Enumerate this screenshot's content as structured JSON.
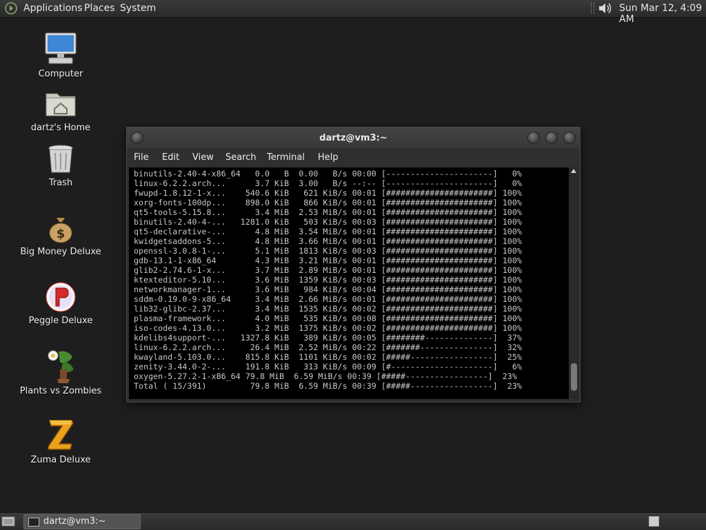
{
  "top_panel": {
    "menus": [
      "Applications",
      "Places",
      "System"
    ],
    "clock": "Sun Mar 12,  4:09 AM",
    "icons": {
      "menu": "gnome-foot-icon",
      "volume": "speaker-icon"
    }
  },
  "desktop": {
    "icons": [
      {
        "label": "Computer",
        "icon": "computer-icon"
      },
      {
        "label": "dartz's Home",
        "icon": "home-folder-icon"
      },
      {
        "label": "Trash",
        "icon": "trash-icon"
      },
      {
        "label": "Big Money Deluxe",
        "icon": "money-bag-icon"
      },
      {
        "label": "Peggle Deluxe",
        "icon": "peggle-icon"
      },
      {
        "label": "Plants vs Zombies",
        "icon": "plants-vs-zombies-icon"
      },
      {
        "label": "Zuma Deluxe",
        "icon": "zuma-icon"
      }
    ]
  },
  "terminal": {
    "title": "dartz@vm3:~",
    "menu": [
      "File",
      "Edit",
      "View",
      "Search",
      "Terminal",
      "Help"
    ],
    "lines": [
      "binutils-2.40-4-x86_64   0.0   B  0.00   B/s 00:00 [----------------------]   0%",
      "linux-6.2.2.arch...      3.7 KiB  3.00   B/s --:-- [----------------------]   0%",
      "fwupd-1.8.12-1-x...    540.6 KiB   621 KiB/s 00:01 [######################] 100%",
      "xorg-fonts-100dp...    898.0 KiB   866 KiB/s 00:01 [######################] 100%",
      "qt5-tools-5.15.8...      3.4 MiB  2.53 MiB/s 00:01 [######################] 100%",
      "binutils-2.40-4-...   1281.0 KiB   503 KiB/s 00:03 [######################] 100%",
      "qt5-declarative-...      4.8 MiB  3.54 MiB/s 00:01 [######################] 100%",
      "kwidgetsaddons-5...      4.8 MiB  3.66 MiB/s 00:01 [######################] 100%",
      "openssl-3.0.8-1-...      5.1 MiB  1813 KiB/s 00:03 [######################] 100%",
      "gdb-13.1-1-x86_64        4.3 MiB  3.21 MiB/s 00:01 [######################] 100%",
      "glib2-2.74.6-1-x...      3.7 MiB  2.89 MiB/s 00:01 [######################] 100%",
      "ktexteditor-5.10...      3.6 MiB  1359 KiB/s 00:03 [######################] 100%",
      "networkmanager-1...      3.6 MiB   984 KiB/s 00:04 [######################] 100%",
      "sddm-0.19.0-9-x86_64     3.4 MiB  2.66 MiB/s 00:01 [######################] 100%",
      "lib32-glibc-2.37...      3.4 MiB  1535 KiB/s 00:02 [######################] 100%",
      "plasma-framework...      4.0 MiB   535 KiB/s 00:08 [######################] 100%",
      "iso-codes-4.13.0...      3.2 MiB  1375 KiB/s 00:02 [######################] 100%",
      "kdelibs4support-...   1327.8 KiB   389 KiB/s 00:05 [########--------------]  37%",
      "linux-6.2.2.arch...     26.4 MiB  2.52 MiB/s 00:22 [#######---------------]  32%",
      "kwayland-5.103.0...    815.8 KiB  1101 KiB/s 00:02 [#####-----------------]  25%",
      "zenity-3.44.0-2-...    191.8 KiB   313 KiB/s 00:09 [#---------------------]   6%",
      "oxygen-5.27.2-1-x86_64 79.8 MiB  6.59 MiB/s 00:39 [#####-----------------]  23%",
      "Total ( 15/391)         79.8 MiB  6.59 MiB/s 00:39 [#####-----------------]  23%"
    ]
  },
  "bottom_panel": {
    "task": "dartz@vm3:~",
    "icons": {
      "show_desktop": "show-desktop-icon",
      "task": "terminal-icon",
      "workspace": "workspace-switcher-icon"
    }
  }
}
